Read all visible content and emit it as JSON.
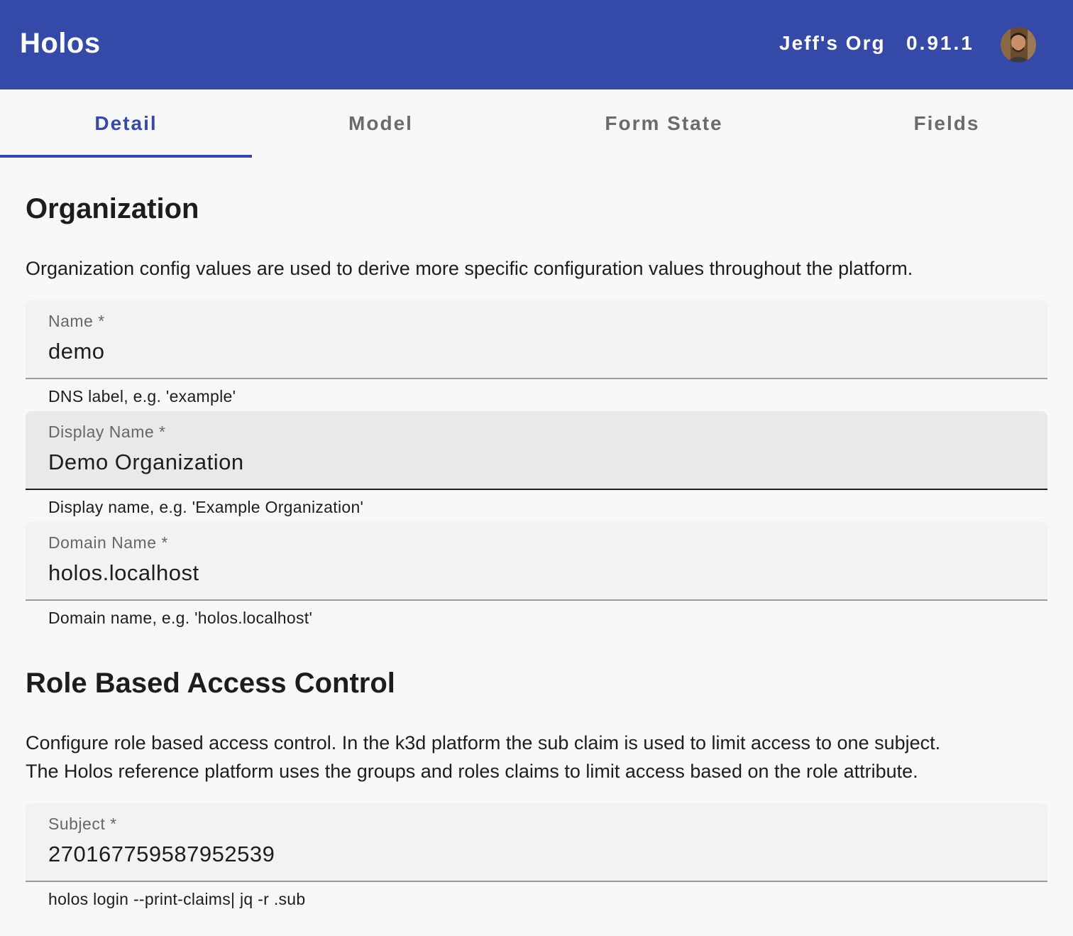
{
  "header": {
    "app_title": "Holos",
    "org_name": "Jeff's Org",
    "version": "0.91.1",
    "avatar_icon": "user-avatar"
  },
  "tabs": [
    {
      "label": "Detail",
      "active": true
    },
    {
      "label": "Model",
      "active": false
    },
    {
      "label": "Form State",
      "active": false
    },
    {
      "label": "Fields",
      "active": false
    }
  ],
  "organization": {
    "title": "Organization",
    "description": "Organization config values are used to derive more specific configuration values throughout the platform.",
    "fields": [
      {
        "label": "Name *",
        "value": "demo",
        "hint": "DNS label, e.g. 'example'"
      },
      {
        "label": "Display Name *",
        "value": "Demo Organization",
        "hint": "Display name, e.g. 'Example Organization'"
      },
      {
        "label": "Domain Name *",
        "value": "holos.localhost",
        "hint": "Domain name, e.g. 'holos.localhost'"
      }
    ]
  },
  "rbac": {
    "title": "Role Based Access Control",
    "description_line1": "Configure role based access control. In the k3d platform the sub claim is used to limit access to one subject.",
    "description_line2": "The Holos reference platform uses the groups and roles claims to limit access based on the role attribute.",
    "fields": [
      {
        "label": "Subject *",
        "value": "270167759587952539",
        "hint": "holos login --print-claims| jq -r .sub"
      }
    ]
  },
  "colors": {
    "primary": "#3449a8",
    "background": "#f8f8f8",
    "field_background": "#f2f2f2"
  }
}
